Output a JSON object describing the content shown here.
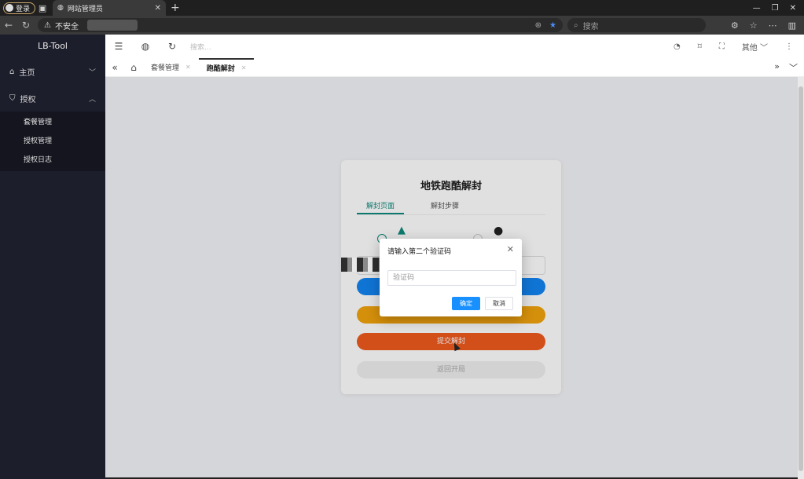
{
  "browser": {
    "profile_label": "登录",
    "tab_title": "网站管理员",
    "address_security": "不安全",
    "search_placeholder": "搜索"
  },
  "sidebar": {
    "brand": "LB-Tool",
    "items": [
      {
        "label": "主页"
      },
      {
        "label": "授权"
      }
    ],
    "submenu": [
      "套餐管理",
      "授权管理",
      "授权日志"
    ]
  },
  "topbar": {
    "search_placeholder": "搜索...",
    "other_label": "其他"
  },
  "tags": {
    "items": [
      {
        "label": "套餐管理"
      },
      {
        "label": "跑酷解封"
      }
    ]
  },
  "card": {
    "title": "地铁跑酷解封",
    "tabs": [
      "解封页面",
      "解封步骤"
    ],
    "buttons": {
      "submit": "提交解封",
      "back": "返回开局"
    }
  },
  "dialog": {
    "title": "请输入第二个验证码",
    "input_placeholder": "验证码",
    "ok_label": "确定",
    "cancel_label": "取消"
  }
}
